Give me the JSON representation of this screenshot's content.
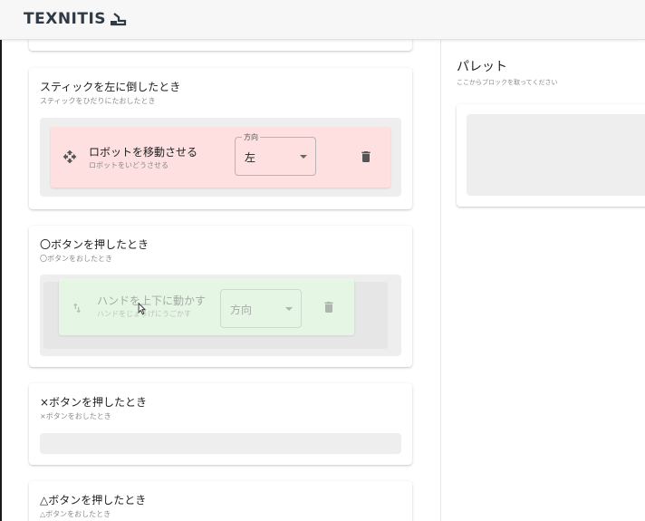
{
  "header": {
    "logo_text": "TEXNITIS"
  },
  "sections": [
    {
      "title": "スティックを左に倒したとき",
      "subtitle": "スティックをひだりにたおしたとき",
      "block": {
        "icon": "move-icon",
        "title": "ロボットを移動させる",
        "subtitle": "ロボットをいどうさせる",
        "select_label": "方向",
        "select_value": "左",
        "color": "#fde0df"
      }
    },
    {
      "title": "〇ボタンを押したとき",
      "subtitle": "〇ボタンをおしたとき",
      "block": {
        "icon": "swap-vert-icon",
        "title": "ハンドを上下に動かす",
        "subtitle": "ハンドをじょうげにうごかす",
        "select_value": "方向",
        "color": "#e7f8e5",
        "state": "dragging"
      }
    },
    {
      "title": "×ボタンを押したとき",
      "subtitle": "×ボタンをおしたとき"
    },
    {
      "title": "△ボタンを押したとき",
      "subtitle": "△ボタンをおしたとき"
    }
  ],
  "palette": {
    "title": "パレット",
    "subtitle": "ここからブロックを取ってください"
  }
}
